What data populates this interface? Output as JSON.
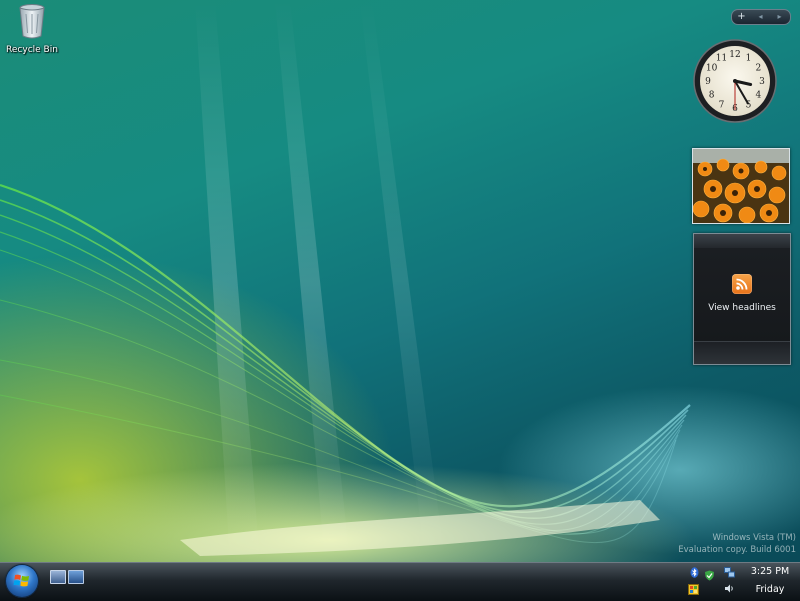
{
  "desktop": {
    "icons": [
      {
        "label": "Recycle Bin",
        "icon": "recycle-bin-icon"
      }
    ],
    "watermark": {
      "line1": "Windows Vista (TM)",
      "line2": "Evaluation copy. Build 6001"
    }
  },
  "sidebar": {
    "controls": {
      "add": "+",
      "prev": "◂",
      "next": "▸"
    },
    "clock": {
      "numerals": [
        "12",
        "1",
        "2",
        "3",
        "4",
        "5",
        "6",
        "7",
        "8",
        "9",
        "10",
        "11"
      ],
      "hour": 3,
      "minute": 25,
      "second": 30
    },
    "slideshow": {
      "subject": "orange flowers photo"
    },
    "feed": {
      "icon": "rss-icon",
      "text": "View headlines"
    }
  },
  "taskbar": {
    "start_icon": "windows-start-orb",
    "quick_launch": [
      "show-desktop-icon",
      "switch-windows-icon"
    ],
    "tray": {
      "icons": [
        "bluetooth-icon",
        "security-shield-icon",
        "network-icon",
        "windows-update-icon",
        "volume-icon"
      ],
      "time": "3:25 PM",
      "day": "Friday"
    }
  },
  "colors": {
    "accent": "#168b82",
    "taskbar": "#20272d",
    "rss": "#f0861f"
  }
}
